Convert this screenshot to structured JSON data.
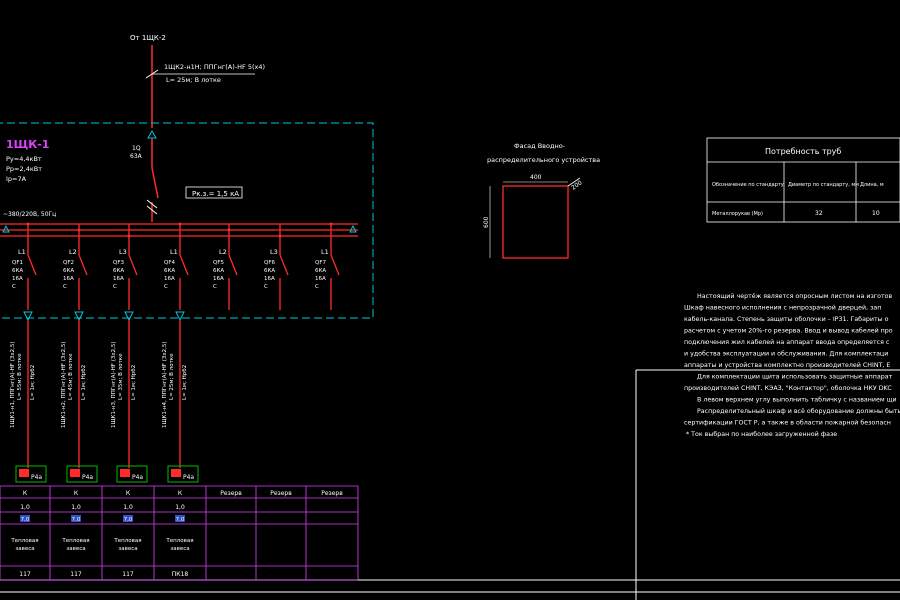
{
  "colors": {
    "background": "#000000",
    "circuit": "#ff2a2a",
    "frame": "#00c8d8",
    "text": "#ffffff",
    "panel_title": "#e040ff",
    "cyan_text": "#40e0ff",
    "green_marker": "#00c000",
    "blue_cell": "#3050c0"
  },
  "feed": {
    "source": "От 1ЩК-2",
    "cable": "1ЩК2-н1Н; ППГнг(А)-HF 5(х4)",
    "length": "L= 25м; В лотке"
  },
  "panel": {
    "name": "1ЩК-1",
    "pu": "Ру=4,4кВт",
    "pr": "Рр=2,4кВт",
    "ip": "Iр=7А",
    "voltage": "~380/220В, 50Гц",
    "main_switch": {
      "id": "1Q",
      "rating": "63А"
    },
    "short_circuit": "Рк.з.= 1,5 кА"
  },
  "breakers": [
    {
      "phase": "L1",
      "id": "QF1",
      "ka": "6КА",
      "amp": "16А",
      "curve": "С"
    },
    {
      "phase": "L2",
      "id": "QF2",
      "ka": "6КА",
      "amp": "16А",
      "curve": "С"
    },
    {
      "phase": "L3",
      "id": "QF3",
      "ka": "6КА",
      "amp": "16А",
      "curve": "С"
    },
    {
      "phase": "L1",
      "id": "QF4",
      "ka": "6КА",
      "amp": "16А",
      "curve": "С"
    },
    {
      "phase": "L2",
      "id": "QF5",
      "ka": "6КА",
      "amp": "16А",
      "curve": "С"
    },
    {
      "phase": "L3",
      "id": "QF6",
      "ka": "6КА",
      "amp": "16А",
      "curve": "С"
    },
    {
      "phase": "L1",
      "id": "QF7",
      "ka": "6КА",
      "amp": "16А",
      "curve": "С"
    }
  ],
  "cables": [
    {
      "line1": "1ЩК1-н1, ППГнг(А)-HF (3х2,5)",
      "line2": "L= 55м; В лотке",
      "line3": "L= 1м; Нрб2"
    },
    {
      "line1": "1ЩК1-н2, ППГнг(А)-HF (3х2,5)",
      "line2": "L= 45м; В лотке",
      "line3": "L= 1м; Нрб2"
    },
    {
      "line1": "1ЩК1-н3, ППГнг(А)-HF (3х2,5)",
      "line2": "L= 35м; В лотке",
      "line3": "L= 1м; Нрб2"
    },
    {
      "line1": "1ЩК1-н4, ППГнг(А)-HF (3х2,5)",
      "line2": "L= 25м; В лотке",
      "line3": "L= 1м; Нрб2"
    }
  ],
  "loads": [
    {
      "label": "Р4а"
    },
    {
      "label": "Р4а"
    },
    {
      "label": "Р4а"
    },
    {
      "label": "Р4а"
    }
  ],
  "table": {
    "row1": [
      "К",
      "К",
      "К",
      "К",
      "Резерв",
      "Резерв",
      "Резерв"
    ],
    "row2": [
      "1,0",
      "1,0",
      "1,0",
      "1,0"
    ],
    "row3": [
      "7,0",
      "7,0",
      "7,0",
      "7,0"
    ],
    "row4": [
      "Тепловая завеса",
      "Тепловая завеса",
      "Тепловая завеса",
      "Тепловая завеса"
    ],
    "row5": [
      "117",
      "117",
      "117",
      "ПК18"
    ]
  },
  "cabinet_view": {
    "title1": "Фасад Вводно-",
    "title2": "распределительного устройства",
    "width": "400",
    "height": "600",
    "depth": "200"
  },
  "pipes_table": {
    "title": "Потребность труб",
    "headers": [
      "Обозначение по стандарту",
      "Диаметр по стандарту, мм",
      "Длина, м"
    ],
    "row": [
      "Металлорукав (Мр)",
      "32",
      "10"
    ]
  },
  "notes": [
    "Настоящий чертёж является опросным листом на изготов",
    "Шкаф навесного исполнения с непрозрачной дверцей, зап",
    "кабель-канала. Степень защиты оболочки – IP31. Габариты о",
    "расчетом с учетом 20%-го резерва. Ввод и вывод кабелей про",
    "подключения жил кабелей на аппарат ввода определяется с",
    "и удобства эксплуатации и обслуживания. Для комплектаци",
    "аппараты и устройства комплектно производителей CHINT, Е",
    "Для комплектации щита использовать защитные аппарат",
    "производителей CHINT, КЭАЗ, \"Контактор\", оболочка НКУ DKC",
    "В левом верхнем углу выполнить табличку с названием щи",
    "Распределительный шкаф и всё оборудование должны быть",
    "сертификации ГОСТ Р, а также в области пожарной безопасн",
    "*  Ток выбран по наиболее загруженной фазе"
  ]
}
